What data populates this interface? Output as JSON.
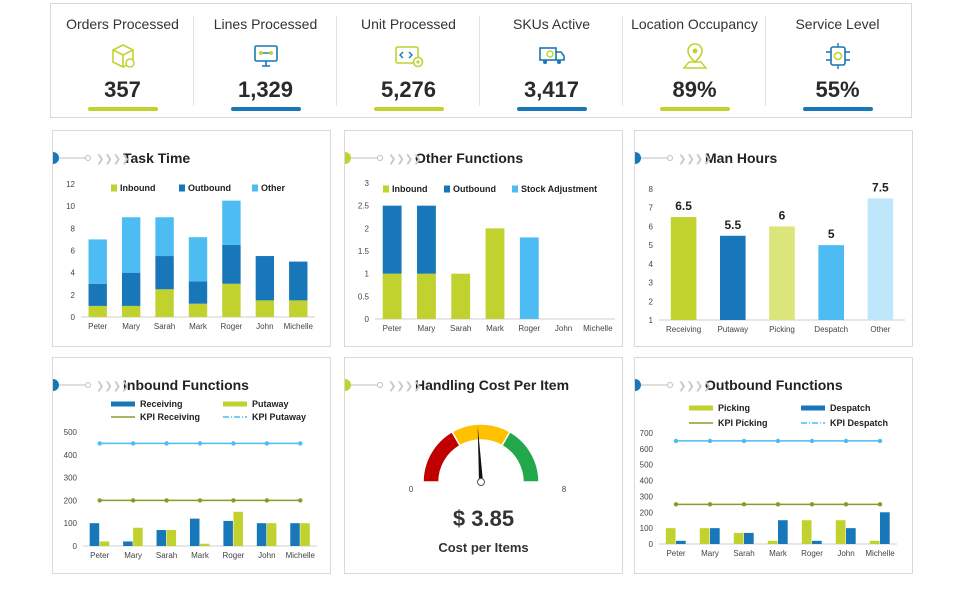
{
  "kpis": [
    {
      "title": "Orders Processed",
      "value": "357",
      "icon": "box-icon",
      "bar_color": "#c1d22e"
    },
    {
      "title": "Lines Processed",
      "value": "1,329",
      "icon": "monitor-network-icon",
      "bar_color": "#1777b8"
    },
    {
      "title": "Unit Processed",
      "value": "5,276",
      "icon": "code-gear-icon",
      "bar_color": "#c1d22e"
    },
    {
      "title": "SKUs Active",
      "value": "3,417",
      "icon": "truck-search-icon",
      "bar_color": "#1777b8"
    },
    {
      "title": "Location Occupancy",
      "value": "89%",
      "icon": "map-pin-icon",
      "bar_color": "#c1d22e"
    },
    {
      "title": "Service  Level",
      "value": "55%",
      "icon": "service-gear-icon",
      "bar_color": "#1777b8"
    }
  ],
  "colors": {
    "green": "#c1d22e",
    "blue": "#1777b8",
    "light_blue": "#4dbcf2",
    "pale_green": "#dce57a",
    "pale_blue": "#bfe6fb"
  },
  "panels": {
    "task_time": {
      "title": "Task Time"
    },
    "other_functions": {
      "title": "Other Functions"
    },
    "man_hours": {
      "title": "Man Hours"
    },
    "inbound_functions": {
      "title": "Inbound Functions"
    },
    "handling_cost": {
      "title": "Handling Cost Per Item",
      "value": "$ 3.85",
      "subtitle": "Cost  per Items"
    },
    "outbound_functions": {
      "title": "Outbound Functions"
    }
  },
  "chart_data": [
    {
      "id": "task_time",
      "type": "bar",
      "stacked": true,
      "categories": [
        "Peter",
        "Mary",
        "Sarah",
        "Mark",
        "Roger",
        "John",
        "Michelle"
      ],
      "series": [
        {
          "name": "Inbound",
          "values": [
            1,
            1,
            2.5,
            1.2,
            3,
            1.5,
            1.5
          ],
          "color": "#c1d22e"
        },
        {
          "name": "Outbound",
          "values": [
            2,
            3,
            3,
            2,
            3.5,
            4,
            3.5
          ],
          "color": "#1777b8"
        },
        {
          "name": "Other",
          "values": [
            4,
            5,
            3.5,
            4,
            4,
            0,
            0
          ],
          "color": "#4dbcf2"
        }
      ],
      "ylim": [
        0,
        12
      ],
      "yticks": [
        0,
        2,
        4,
        6,
        8,
        10,
        12
      ]
    },
    {
      "id": "other_functions",
      "type": "bar",
      "stacked": true,
      "categories": [
        "Peter",
        "Mary",
        "Sarah",
        "Mark",
        "Roger",
        "John",
        "Michelle"
      ],
      "series": [
        {
          "name": "Inbound",
          "values": [
            1,
            1,
            1,
            2,
            0,
            0,
            0
          ],
          "color": "#c1d22e"
        },
        {
          "name": "Outbound",
          "values": [
            1.5,
            1.5,
            0,
            0,
            0,
            0,
            0
          ],
          "color": "#1777b8"
        },
        {
          "name": "Stock Adjustment",
          "values": [
            0,
            0,
            0,
            0,
            1.8,
            0,
            0
          ],
          "color": "#4dbcf2"
        }
      ],
      "ylim": [
        0,
        3
      ],
      "yticks": [
        0,
        0.5,
        1,
        1.5,
        2,
        2.5,
        3
      ]
    },
    {
      "id": "man_hours",
      "type": "bar",
      "categories": [
        "Receiving",
        "Putaway",
        "Picking",
        "Despatch",
        "Other"
      ],
      "values": [
        6.5,
        5.5,
        6,
        5,
        7.5
      ],
      "data_labels": [
        "6.5",
        "5.5",
        "6",
        "5",
        "7.5"
      ],
      "colors": [
        "#c1d22e",
        "#1777b8",
        "#dce57a",
        "#4dbcf2",
        "#bfe6fb"
      ],
      "ylim": [
        1,
        8
      ],
      "yticks": [
        1,
        2,
        3,
        4,
        5,
        6,
        7,
        8
      ]
    },
    {
      "id": "inbound_functions",
      "type": "bar",
      "categories": [
        "Peter",
        "Mary",
        "Sarah",
        "Mark",
        "Roger",
        "John",
        "Michelle"
      ],
      "series": [
        {
          "name": "Receiving",
          "type": "bar",
          "values": [
            100,
            20,
            70,
            120,
            110,
            100,
            100
          ],
          "color": "#1777b8"
        },
        {
          "name": "Putaway",
          "type": "bar",
          "values": [
            20,
            80,
            70,
            10,
            150,
            100,
            100
          ],
          "color": "#c1d22e"
        },
        {
          "name": "KPI Receiving",
          "type": "line",
          "values": [
            200,
            200,
            200,
            200,
            200,
            200,
            200
          ],
          "color": "#8a9a2a"
        },
        {
          "name": "KPI Putaway",
          "type": "line",
          "values": [
            450,
            450,
            450,
            450,
            450,
            450,
            450
          ],
          "color": "#4dbcf2"
        }
      ],
      "ylim": [
        0,
        500
      ],
      "yticks": [
        0,
        100,
        200,
        300,
        400,
        500
      ]
    },
    {
      "id": "handling_cost",
      "type": "gauge",
      "min": 0,
      "max": 8,
      "value": 3.85,
      "min_label": "0",
      "max_label": "8",
      "bands": [
        {
          "from": 0,
          "to": 2.67,
          "color": "#c00000"
        },
        {
          "from": 2.67,
          "to": 5.33,
          "color": "#ffc000"
        },
        {
          "from": 5.33,
          "to": 8,
          "color": "#22a84a"
        }
      ]
    },
    {
      "id": "outbound_functions",
      "type": "bar",
      "categories": [
        "Peter",
        "Mary",
        "Sarah",
        "Mark",
        "Roger",
        "John",
        "Michelle"
      ],
      "series": [
        {
          "name": "Picking",
          "type": "bar",
          "values": [
            100,
            100,
            70,
            20,
            150,
            150,
            20
          ],
          "color": "#c1d22e"
        },
        {
          "name": "Despatch",
          "type": "bar",
          "values": [
            20,
            100,
            70,
            150,
            20,
            100,
            200
          ],
          "color": "#1777b8"
        },
        {
          "name": "KPI Picking",
          "type": "line",
          "values": [
            250,
            250,
            250,
            250,
            250,
            250,
            250
          ],
          "color": "#8a9a2a"
        },
        {
          "name": "KPI Despatch",
          "type": "line",
          "values": [
            650,
            650,
            650,
            650,
            650,
            650,
            650
          ],
          "color": "#4dbcf2"
        }
      ],
      "ylim": [
        0,
        700
      ],
      "yticks": [
        0,
        100,
        200,
        300,
        400,
        500,
        600,
        700
      ]
    }
  ]
}
